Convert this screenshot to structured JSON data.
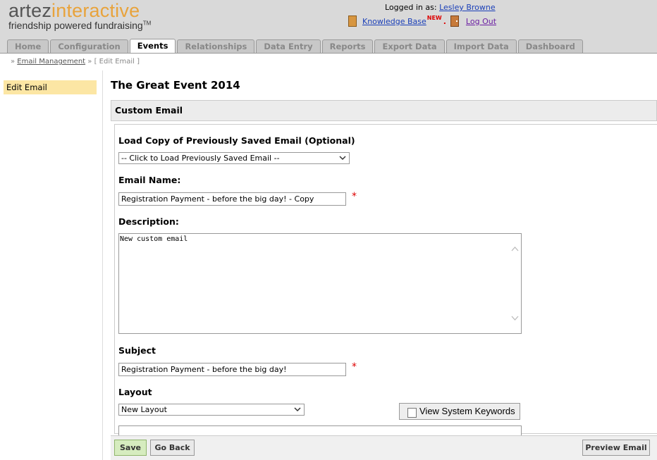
{
  "header": {
    "logo_main": "artez",
    "logo_accent": "interactive",
    "logo_tagline": "friendship powered fundraising",
    "logo_tm": "TM",
    "logged_in_label": "Logged in as:",
    "user_name": "Lesley Browne",
    "knowledge_base": "Knowledge Base",
    "new_tag": "NEW",
    "dot": ".",
    "logout": "Log Out"
  },
  "tabs": [
    {
      "label": "Home"
    },
    {
      "label": "Configuration"
    },
    {
      "label": "Events",
      "active": true
    },
    {
      "label": "Relationships"
    },
    {
      "label": "Data Entry"
    },
    {
      "label": "Reports"
    },
    {
      "label": "Export Data"
    },
    {
      "label": "Import Data"
    },
    {
      "label": "Dashboard"
    }
  ],
  "breadcrumb": {
    "link": "Email Management",
    "current": "[ Edit Email ]"
  },
  "sidebar": {
    "item": "Edit Email"
  },
  "page_title": "The Great Event 2014",
  "panel": {
    "title": "Custom Email",
    "load_copy_label": "Load Copy of Previously Saved Email (Optional)",
    "load_copy_value": "-- Click to Load Previously Saved Email --",
    "email_name_label": "Email Name:",
    "email_name_value": "Registration Payment - before the big day! - Copy",
    "description_label": "Description:",
    "description_value": "New custom email",
    "subject_label": "Subject",
    "subject_value": "Registration Payment - before the big day!",
    "layout_label": "Layout",
    "layout_value": "New Layout",
    "view_keywords": "View System Keywords",
    "required_mark": "*"
  },
  "buttons": {
    "save": "Save",
    "go_back": "Go Back",
    "preview": "Preview Email"
  },
  "colors": {
    "accent": "#e8a33c",
    "link": "#1a3fb8",
    "required": "#dd0000",
    "sidebar_active": "#fce6a4",
    "save_button": "#d6ecbf"
  }
}
